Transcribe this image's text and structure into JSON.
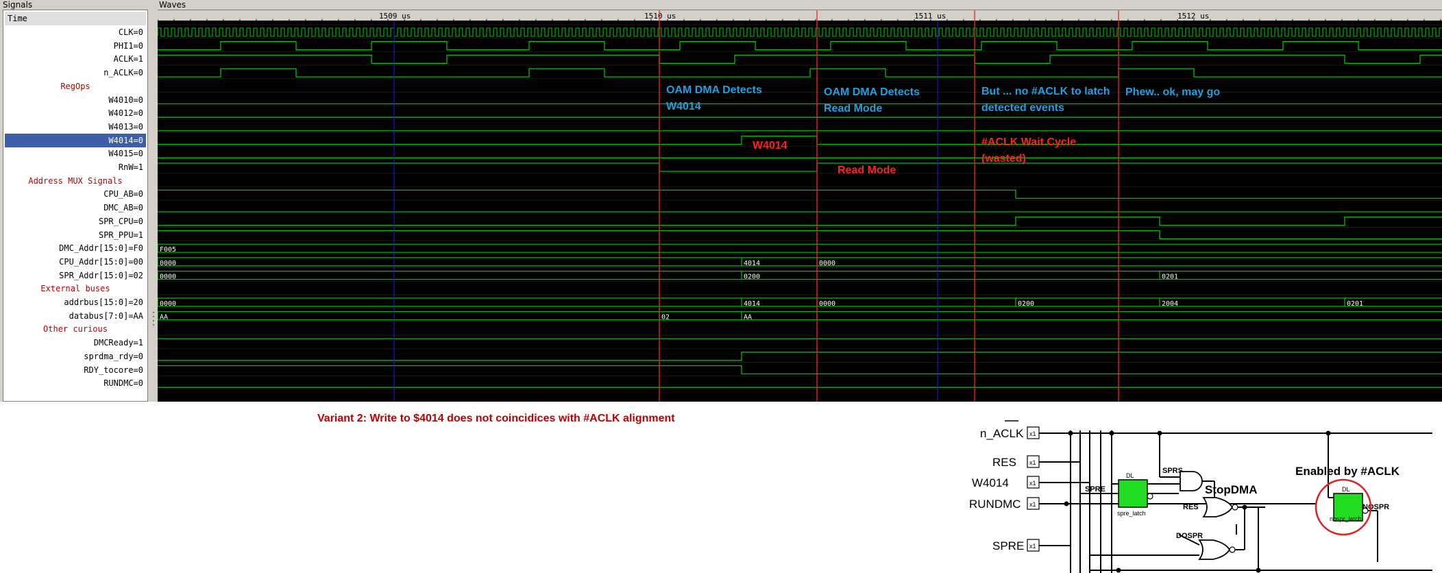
{
  "panels": {
    "signals_title": "Signals",
    "waves_title": "Waves",
    "time_header": "Time"
  },
  "signals": [
    {
      "label": "CLK=0",
      "type": "signal"
    },
    {
      "label": "PHI1=0",
      "type": "signal"
    },
    {
      "label": "ACLK=1",
      "type": "signal"
    },
    {
      "label": "n_ACLK=0",
      "type": "signal"
    },
    {
      "label": "RegOps",
      "type": "group"
    },
    {
      "label": "W4010=0",
      "type": "signal"
    },
    {
      "label": "W4012=0",
      "type": "signal"
    },
    {
      "label": "W4013=0",
      "type": "signal"
    },
    {
      "label": "W4014=0",
      "type": "signal",
      "selected": true
    },
    {
      "label": "W4015=0",
      "type": "signal"
    },
    {
      "label": "RnW=1",
      "type": "signal"
    },
    {
      "label": "Address MUX Signals",
      "type": "group"
    },
    {
      "label": "CPU_AB=0",
      "type": "signal"
    },
    {
      "label": "DMC_AB=0",
      "type": "signal"
    },
    {
      "label": "SPR_CPU=0",
      "type": "signal"
    },
    {
      "label": "SPR_PPU=1",
      "type": "signal"
    },
    {
      "label": "DMC_Addr[15:0]=F0",
      "type": "signal"
    },
    {
      "label": "CPU_Addr[15:0]=00",
      "type": "signal"
    },
    {
      "label": "SPR_Addr[15:0]=02",
      "type": "signal"
    },
    {
      "label": "External buses",
      "type": "group"
    },
    {
      "label": "addrbus[15:0]=20",
      "type": "signal"
    },
    {
      "label": "databus[7:0]=AA",
      "type": "signal"
    },
    {
      "label": "Other curious",
      "type": "group"
    },
    {
      "label": "DMCReady=1",
      "type": "signal"
    },
    {
      "label": "sprdma_rdy=0",
      "type": "signal"
    },
    {
      "label": "RDY_tocore=0",
      "type": "signal"
    },
    {
      "label": "RUNDMC=0",
      "type": "signal"
    }
  ],
  "time_axis": {
    "labels": [
      "1509 us",
      "1510 us",
      "1511 us",
      "1512 us"
    ]
  },
  "bus_values": {
    "dmc_addr": [
      "F005"
    ],
    "cpu_addr": [
      "0000",
      "4014",
      "0000"
    ],
    "spr_addr": [
      "0000",
      "0200",
      "0201"
    ],
    "addrbus": [
      "0000",
      "4014",
      "0000",
      "0200",
      "2004",
      "0201"
    ],
    "databus": [
      "AA",
      "02",
      "AA"
    ]
  },
  "annotations": {
    "oam_detects_w4014_line1": "OAM DMA Detects",
    "oam_detects_w4014_line2": "W4014",
    "oam_detects_read_line1": "OAM DMA Detects",
    "oam_detects_read_line2": "Read Mode",
    "no_aclk_line1": "But ... no #ACLK to latch",
    "no_aclk_line2": "detected events",
    "phew": "Phew.. ok, may go",
    "w4014_label": "W4014",
    "read_mode_label": "Read Mode",
    "wait_cycle_line1": "#ACLK Wait Cycle",
    "wait_cycle_line2": "(wasted)"
  },
  "caption": "Variant 2: Write to $4014 does not coincidices with #ACLK alignment",
  "circuit": {
    "inputs": [
      "n_ACLK",
      "RES",
      "W4014",
      "RUNDMC",
      "SPRE"
    ],
    "pin_tag": "x1",
    "enabled_note": "Enabled by #ACLK",
    "latch_label": "DL",
    "spre_latch_name": "spre_latch",
    "nospr_latch_name": "nospr_latch",
    "net_spre": "SPRE",
    "net_sprs": "SPRS",
    "net_res": "RES",
    "net_dospr": "DOSPR",
    "net_nospr": "NOSPR",
    "stopdma": "StopDMA"
  },
  "colors": {
    "wave": "#00c000",
    "marker": "#ff2020",
    "cursor": "#2020d0",
    "annot_blue": "#1ea0e0",
    "annot_red": "#ff2020",
    "latch_fill": "#22dd22"
  }
}
